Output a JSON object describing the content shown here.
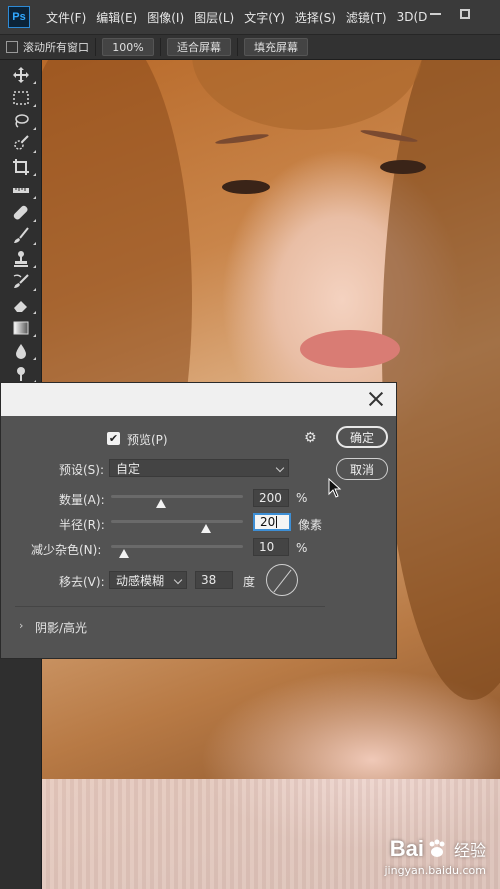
{
  "app": {
    "logo_text": "Ps"
  },
  "menu": {
    "items": [
      "文件(F)",
      "编辑(E)",
      "图像(I)",
      "图层(L)",
      "文字(Y)",
      "选择(S)",
      "滤镜(T)",
      "3D(D"
    ]
  },
  "options_bar": {
    "scroll_all_windows_label": "滚动所有窗口",
    "zoom_value": "100%",
    "fit_screen_label": "适合屏幕",
    "fill_screen_label": "填充屏幕"
  },
  "tools": [
    "move-tool",
    "marquee-tool",
    "lasso-tool",
    "quick-selection-tool",
    "crop-tool",
    "ruler-tool",
    "healing-brush-tool",
    "brush-tool",
    "stamp-tool",
    "history-brush-tool",
    "eraser-tool",
    "gradient-tool",
    "blur-tool",
    "dodge-tool"
  ],
  "dialog": {
    "preview_label": "预览(P)",
    "preview_checked": true,
    "preset_label": "预设(S):",
    "preset_value": "自定",
    "amount_label": "数量(A):",
    "amount_value": "200",
    "amount_unit": "%",
    "amount_slider_fraction": 0.38,
    "radius_label": "半径(R):",
    "radius_value": "20",
    "radius_unit": "像素",
    "radius_slider_fraction": 0.72,
    "noise_label": "减少杂色(N):",
    "noise_value": "10",
    "noise_unit": "%",
    "noise_slider_fraction": 0.1,
    "remove_label": "移去(V):",
    "remove_value": "动感模糊",
    "angle_value": "38",
    "angle_unit": "度",
    "shadows_highlights_label": "阴影/高光",
    "ok_label": "确定",
    "cancel_label": "取消"
  },
  "watermark": {
    "brand_left": "Bai",
    "brand_right": "经验",
    "url": "jingyan.baidu.com"
  }
}
